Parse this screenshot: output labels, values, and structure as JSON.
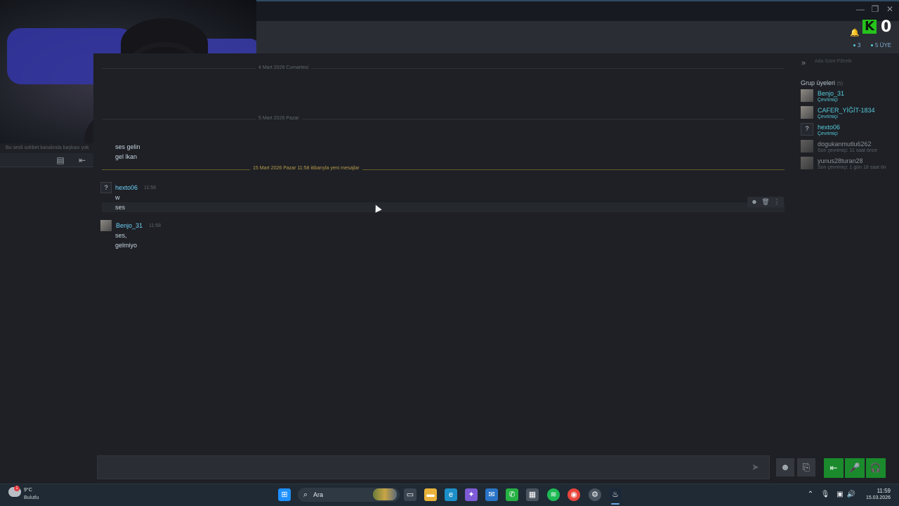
{
  "window": {
    "minimize": "—",
    "restore": "❐",
    "close": "✕"
  },
  "header": {
    "k_letter": "K",
    "k_count": "0",
    "online_count": "3",
    "member_count": "5 ÜYE"
  },
  "sidebar": {
    "note": "Bu sesli sohbet kanalında başkası yok"
  },
  "chat": {
    "day_dividers": [
      "4 Mart 2026 Cumartesi",
      "5 Mart 2026 Pazar"
    ],
    "new_messages_divider": "15 Mart 2026 Pazar 11:58 itibarıyla yeni mesajlar",
    "early_messages": [
      "ses gelin",
      "gel lkan"
    ],
    "groups": [
      {
        "author": "hexto06",
        "time": "11:58",
        "avatar": "?",
        "messages": [
          "w",
          "ses"
        ]
      },
      {
        "author": "Benjo_31",
        "time": "11:58",
        "messages": [
          "ses,",
          "gelmiyo"
        ]
      }
    ]
  },
  "members_panel": {
    "filter_placeholder": "Ada Göre Filtrele",
    "title": "Grup üyeleri",
    "count": "(5)",
    "members": [
      {
        "name": "Benjo_31",
        "status": "Çevrimiçi",
        "online": true
      },
      {
        "name": "CAFER_YİĞİT-1834",
        "status": "Çevrimiçi",
        "online": true
      },
      {
        "name": "hexto06",
        "status": "Çevrimiçi",
        "online": true
      },
      {
        "name": "dogukanmutlu6262",
        "status": "Son çevrimiçi: 11 saat önce",
        "online": false
      },
      {
        "name": "yunus28turan28",
        "status": "Son çevrimiçi: 1 gün 18 saat ön",
        "online": false
      }
    ]
  },
  "taskbar": {
    "temperature": "9°C",
    "weather": "Bulutlu",
    "search_label": "Ara",
    "time": "11:59",
    "date": "15.03.2026"
  },
  "icons": {
    "send": "send-icon",
    "emoji": "emoji-icon",
    "attach": "attach-icon",
    "leave_voice": "leave-voice-icon",
    "mic": "microphone-icon",
    "headphones": "headphones-icon"
  },
  "colors": {
    "accent": "#6dcff6",
    "online": "#57cbde",
    "voice_green": "#1a8a2c",
    "new_messages": "#b59a4a"
  }
}
